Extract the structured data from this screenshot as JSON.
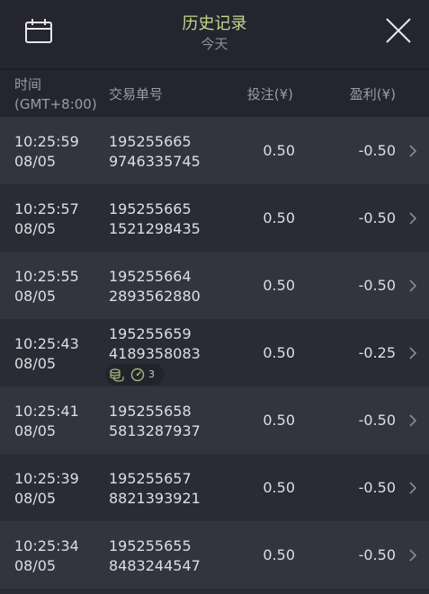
{
  "header": {
    "title": "历史记录",
    "subtitle": "今天",
    "title_color": "#c3d98c"
  },
  "columns": {
    "time_line1": "时间",
    "time_line2": "(GMT+8:00)",
    "id": "交易单号",
    "bet": "投注(¥)",
    "profit": "盈利(¥)"
  },
  "rows": [
    {
      "time": "10:25:59",
      "date": "08/05",
      "id_line1": "195255665",
      "id_line2": "9746335745",
      "bet": "0.50",
      "profit": "-0.50"
    },
    {
      "time": "10:25:57",
      "date": "08/05",
      "id_line1": "195255665",
      "id_line2": "1521298435",
      "bet": "0.50",
      "profit": "-0.50"
    },
    {
      "time": "10:25:55",
      "date": "08/05",
      "id_line1": "195255664",
      "id_line2": "2893562880",
      "bet": "0.50",
      "profit": "-0.50"
    },
    {
      "time": "10:25:43",
      "date": "08/05",
      "id_line1": "195255659",
      "id_line2": "4189358083",
      "bet": "0.50",
      "profit": "-0.25",
      "badge": {
        "icons": [
          "coins-icon",
          "gauge-icon"
        ],
        "count": "3"
      }
    },
    {
      "time": "10:25:41",
      "date": "08/05",
      "id_line1": "195255658",
      "id_line2": "5813287937",
      "bet": "0.50",
      "profit": "-0.50"
    },
    {
      "time": "10:25:39",
      "date": "08/05",
      "id_line1": "195255657",
      "id_line2": "8821393921",
      "bet": "0.50",
      "profit": "-0.50"
    },
    {
      "time": "10:25:34",
      "date": "08/05",
      "id_line1": "195255655",
      "id_line2": "8483244547",
      "bet": "0.50",
      "profit": "-0.50"
    }
  ],
  "icons": {
    "calendar": "calendar-icon",
    "close": "close-icon",
    "chevron": "chevron-right-icon"
  }
}
